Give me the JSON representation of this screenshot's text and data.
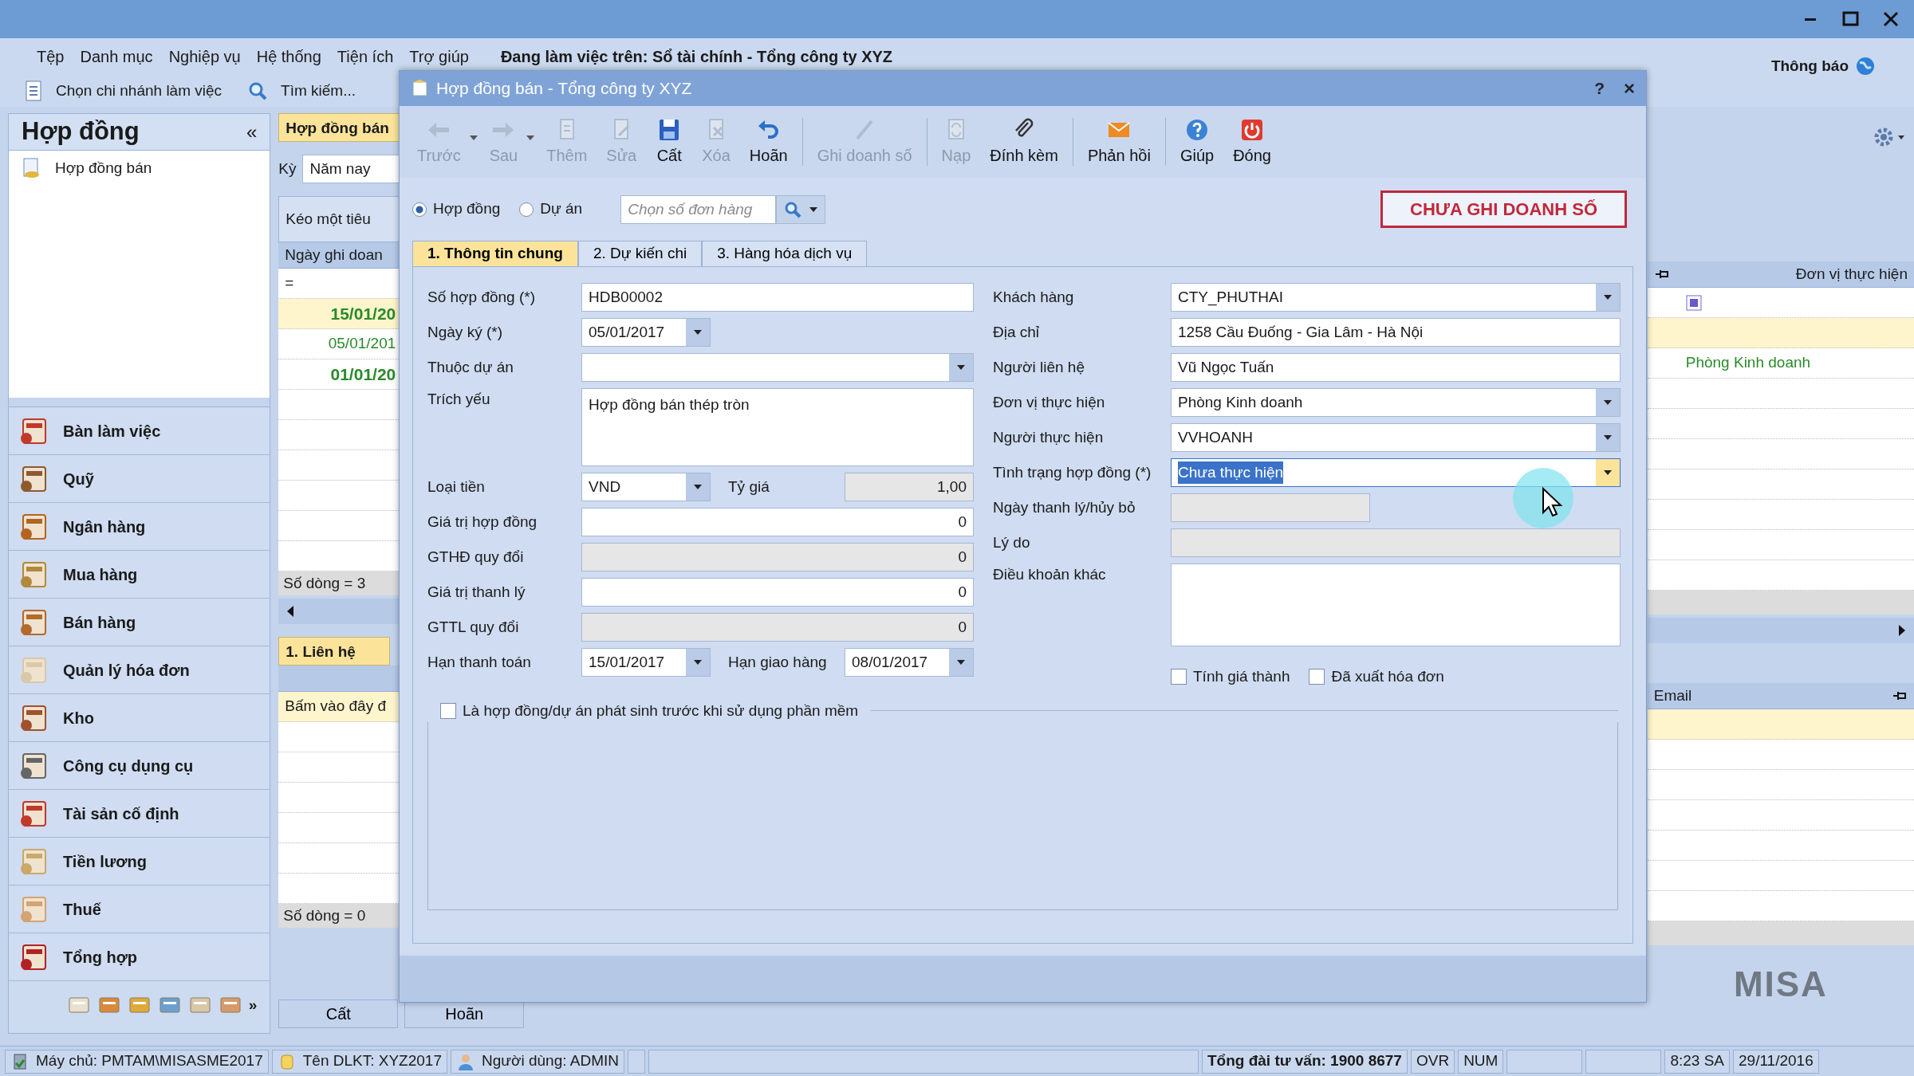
{
  "app": {
    "menu": [
      "Tệp",
      "Danh mục",
      "Nghiệp vụ",
      "Hệ thống",
      "Tiện ích",
      "Trợ giúp"
    ],
    "working_on": "Đang làm việc trên: Sổ tài chính - Tổng công ty XYZ",
    "notify": "Thông báo",
    "toolbar": [
      "Chọn chi nhánh làm việc",
      "Tìm kiếm..."
    ]
  },
  "sidebar": {
    "title": "Hợp đồng",
    "collapse": "«",
    "tree": [
      "Hợp đồng bán"
    ],
    "modules": [
      "Bàn làm việc",
      "Quỹ",
      "Ngân hàng",
      "Mua hàng",
      "Bán hàng",
      "Quản lý hóa đơn",
      "Kho",
      "Công cụ dụng cụ",
      "Tài sản cố định",
      "Tiền lương",
      "Thuế",
      "Tổng hợp"
    ],
    "more": "»"
  },
  "list_panel": {
    "tab": "Hợp đồng bán",
    "period_label": "Kỳ",
    "period": "Năm nay",
    "group_hint": "Kéo một tiêu",
    "column_1": "Ngày ghi doan",
    "column_2": "Đơn vị thực hiện",
    "filter": "=",
    "rows": [
      {
        "date": "15/01/20",
        "bold": true,
        "selected": true
      },
      {
        "date": "05/01/201",
        "bold": false,
        "selected": false,
        "unit": "Phòng Kinh doanh"
      },
      {
        "date": "01/01/20",
        "bold": true,
        "selected": false
      }
    ],
    "row_count": "Số dòng = 3",
    "detail_tab": "1. Liên hệ",
    "add_hint": "Bấm vào đây đ",
    "detail_column_2": "Email",
    "detail_count": "Số dòng = 0",
    "buttons": [
      "Cất",
      "Hoãn"
    ],
    "logo": "MISA"
  },
  "dialog": {
    "title": "Hợp đồng bán - Tổng công ty XYZ",
    "help": "?",
    "close": "×",
    "toolbar": [
      {
        "label": "Trước",
        "kind": "back",
        "disabled": true,
        "dropdown": true
      },
      {
        "label": "Sau",
        "kind": "forward",
        "disabled": true,
        "dropdown": true
      },
      {
        "label": "Thêm",
        "kind": "add",
        "disabled": true,
        "dropdown": false
      },
      {
        "label": "Sửa",
        "kind": "edit",
        "disabled": true,
        "dropdown": false
      },
      {
        "label": "Cất",
        "kind": "save",
        "disabled": false,
        "dropdown": false
      },
      {
        "label": "Xóa",
        "kind": "delete",
        "disabled": true,
        "dropdown": false
      },
      {
        "label": "Hoãn",
        "kind": "undo",
        "disabled": false,
        "dropdown": false
      },
      {
        "kind": "separator"
      },
      {
        "label": "Ghi doanh số",
        "kind": "pencil",
        "disabled": true,
        "dropdown": false
      },
      {
        "kind": "separator"
      },
      {
        "label": "Nạp",
        "kind": "reload",
        "disabled": true,
        "dropdown": false
      },
      {
        "label": "Đính kèm",
        "kind": "paperclip",
        "disabled": false,
        "dropdown": false
      },
      {
        "kind": "separator"
      },
      {
        "label": "Phản hồi",
        "kind": "mail",
        "disabled": false,
        "dropdown": false
      },
      {
        "kind": "separator"
      },
      {
        "label": "Giúp",
        "kind": "help",
        "disabled": false,
        "dropdown": false
      },
      {
        "label": "Đóng",
        "kind": "power",
        "disabled": false,
        "dropdown": false
      }
    ],
    "options": [
      {
        "label": "Hợp đồng",
        "selected": true
      },
      {
        "label": "Dự án",
        "selected": false
      }
    ],
    "search": {
      "placeholder": "Chọn số đơn hàng"
    },
    "status": "CHƯA GHI DOANH SỐ",
    "tabs": [
      {
        "label": "1. Thông tin chung",
        "selected": true
      },
      {
        "label": "2. Dự kiến chi",
        "selected": false
      },
      {
        "label": "3. Hàng hóa dịch vụ",
        "selected": false
      }
    ],
    "left_rows": [
      [
        {
          "label": "Số hợp đồng (*)",
          "value": "HDB00002",
          "kind": "text"
        }
      ],
      [
        {
          "label": "Ngày ký (*)",
          "value": "05/01/2017",
          "kind": "short_combo"
        }
      ],
      [
        {
          "label": "Thuộc dự án",
          "kind": "combo"
        }
      ],
      [
        {
          "label": "Trích yếu",
          "value": "Hợp đồng bán thép tròn",
          "kind": "memo"
        }
      ],
      [
        {
          "label": "Loại tiền",
          "value": "VND",
          "kind": "short_combo"
        },
        {
          "label": "Tỷ giá",
          "value": "1,00",
          "kind": "readonly_number"
        }
      ],
      [
        {
          "label": "Giá trị hợp đồng",
          "value": "0",
          "kind": "number"
        }
      ],
      [
        {
          "label": "GTHĐ quy đổi",
          "value": "0",
          "kind": "readonly_number"
        }
      ],
      [
        {
          "label": "Giá trị thanh lý",
          "value": "0",
          "kind": "number"
        }
      ],
      [
        {
          "label": "GTTL quy đổi",
          "value": "0",
          "kind": "readonly_number"
        }
      ],
      [
        {
          "label": "Hạn thanh toán",
          "value": "15/01/2017",
          "kind": "short_combo"
        },
        {
          "label": "Hạn giao hàng",
          "value": "08/01/2017",
          "kind": "short_combo"
        }
      ]
    ],
    "right_fields": [
      {
        "label": "Khách hàng",
        "value": "CTY_PHUTHAI",
        "kind": "combo",
        "focused": false
      },
      {
        "label": "Địa chỉ",
        "value": "1258 Cầu Đuống - Gia Lâm - Hà Nội",
        "kind": "text",
        "focused": false
      },
      {
        "label": "Người liên hệ",
        "value": "Vũ Ngọc Tuấn",
        "kind": "text",
        "focused": false
      },
      {
        "label": "Đơn vị thực hiện",
        "value": "Phòng Kinh doanh",
        "kind": "combo",
        "focused": false
      },
      {
        "label": "Người thực hiện",
        "value": "VVHOANH",
        "kind": "combo",
        "focused": false
      },
      {
        "label": "Tình trạng hợp đồng (*)",
        "value": "Chưa thực hiện",
        "kind": "combo",
        "focused": true
      },
      {
        "label": "Ngày thanh lý/hủy bỏ",
        "kind": "readonly_short",
        "focused": false
      },
      {
        "label": "Lý do",
        "kind": "readonly",
        "focused": false
      },
      {
        "label": "Điều khoản khác",
        "kind": "memo",
        "focused": false
      }
    ],
    "checks": [
      {
        "label": "Tính giá thành",
        "checked": false
      },
      {
        "label": "Đã xuất hóa đơn",
        "checked": false
      }
    ],
    "group": {
      "label": "Là hợp đồng/dự án phát sinh trước khi sử dụng phần mềm",
      "checked": false
    }
  },
  "status_bar": [
    {
      "text": "Máy chủ: PMTAM\\MISASME2017",
      "kind": "server"
    },
    {
      "text": "Tên DLKT: XYZ2017",
      "kind": "database"
    },
    {
      "text": "Người dùng: ADMIN",
      "kind": "user"
    },
    {
      "kind": "spacer"
    },
    {
      "kind": "wide_spacer"
    },
    {
      "text": "Tổng đài tư vấn: 1900 8677",
      "kind": "bold"
    },
    {
      "text": "OVR",
      "kind": "plain"
    },
    {
      "text": "NUM",
      "kind": "plain"
    },
    {
      "kind": "spacer"
    },
    {
      "kind": "spacer"
    },
    {
      "text": "8:23 SA",
      "kind": "plain"
    },
    {
      "text": "29/11/2016",
      "kind": "plain"
    }
  ]
}
